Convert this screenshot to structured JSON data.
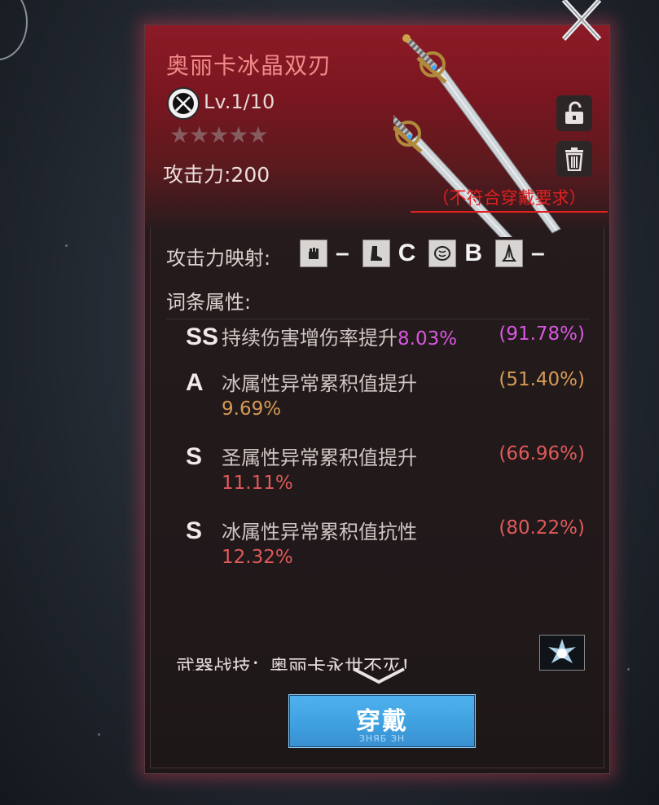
{
  "item": {
    "title": "奥丽卡冰晶双刃",
    "level": "Lv.1/10",
    "stars": "★★★★★",
    "attack": "攻击力:200",
    "requirement": "（不符合穿戴要求）"
  },
  "icons": {
    "weapon_type": "crossed-swords-icon",
    "lock": "unlock-icon",
    "delete": "trash-icon",
    "close": "close-x-icon"
  },
  "attack_mapping": {
    "label": "攻击力映射:",
    "stats": [
      {
        "icon": "fist-icon",
        "grade": "–"
      },
      {
        "icon": "boot-icon",
        "grade": "C"
      },
      {
        "icon": "brain-icon",
        "grade": "B"
      },
      {
        "icon": "praying-hands-icon",
        "grade": "–"
      }
    ]
  },
  "attributes": {
    "label": "词条属性:",
    "items": [
      {
        "rank": "SS",
        "name": "持续伤害增伤率提升",
        "value": "8.03%",
        "percent": "(91.78%)"
      },
      {
        "rank": "A",
        "name": "冰属性异常累积值提升",
        "value": "9.69%",
        "percent": "(51.40%)"
      },
      {
        "rank": "S",
        "name": "圣属性异常累积值提升",
        "value": "11.11%",
        "percent": "(66.96%)"
      },
      {
        "rank": "S",
        "name": "冰属性异常累积值抗性",
        "value": "12.32%",
        "percent": "(80.22%)"
      }
    ]
  },
  "skill": {
    "text": "武器战技：奥丽卡永世不灭！"
  },
  "button": {
    "equip_label": "穿戴",
    "equip_sub": "ЗНЯБ ЗН"
  },
  "colors": {
    "magenta": "#d957e0",
    "orange": "#d79a55",
    "red": "#e05a5a",
    "button_blue": "#4fb2ee"
  }
}
